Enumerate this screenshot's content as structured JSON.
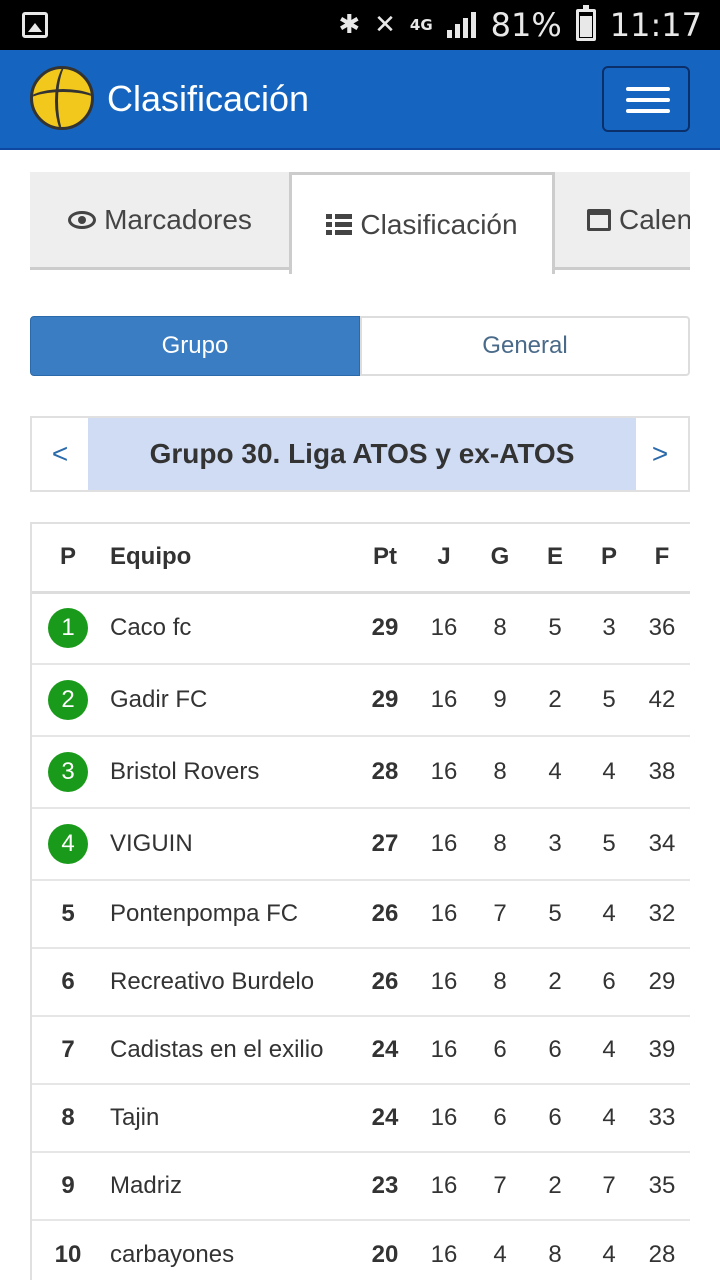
{
  "status_bar": {
    "battery": "81%",
    "time": "11:17",
    "network": "4G",
    "icons": [
      "image-icon",
      "bluetooth-icon",
      "mute-icon",
      "signal-icon",
      "battery-icon"
    ]
  },
  "navbar": {
    "title": "Clasificación",
    "logo": "volleyball-logo",
    "menu_icon": "hamburger-menu-icon",
    "color": "#1565c0"
  },
  "tabs": [
    {
      "label": "Marcadores",
      "icon": "eye-icon",
      "active": false
    },
    {
      "label": "Clasificación",
      "icon": "list-icon",
      "active": true
    },
    {
      "label": "Calendario",
      "icon": "calendar-icon",
      "active": false
    }
  ],
  "toggle": {
    "grupo": "Grupo",
    "general": "General",
    "selected": "Grupo"
  },
  "pager": {
    "prev": "<",
    "title": "Grupo 30. Liga ATOS y ex-ATOS",
    "next": ">"
  },
  "table": {
    "headers": [
      "P",
      "Equipo",
      "Pt",
      "J",
      "G",
      "E",
      "P",
      "F"
    ],
    "rows": [
      {
        "pos": "1",
        "team": "Caco fc",
        "pt": "29",
        "j": "16",
        "g": "8",
        "e": "5",
        "p": "3",
        "f": "36",
        "highlight": true
      },
      {
        "pos": "2",
        "team": "Gadir FC",
        "pt": "29",
        "j": "16",
        "g": "9",
        "e": "2",
        "p": "5",
        "f": "42",
        "highlight": true
      },
      {
        "pos": "3",
        "team": "Bristol Rovers",
        "pt": "28",
        "j": "16",
        "g": "8",
        "e": "4",
        "p": "4",
        "f": "38",
        "highlight": true
      },
      {
        "pos": "4",
        "team": "VIGUIN",
        "pt": "27",
        "j": "16",
        "g": "8",
        "e": "3",
        "p": "5",
        "f": "34",
        "highlight": true
      },
      {
        "pos": "5",
        "team": "Pontenpompa FC",
        "pt": "26",
        "j": "16",
        "g": "7",
        "e": "5",
        "p": "4",
        "f": "32",
        "highlight": false
      },
      {
        "pos": "6",
        "team": "Recreativo Burdelo",
        "pt": "26",
        "j": "16",
        "g": "8",
        "e": "2",
        "p": "6",
        "f": "29",
        "highlight": false
      },
      {
        "pos": "7",
        "team": "Cadistas en el exilio",
        "pt": "24",
        "j": "16",
        "g": "6",
        "e": "6",
        "p": "4",
        "f": "39",
        "highlight": false
      },
      {
        "pos": "8",
        "team": "Tajin",
        "pt": "24",
        "j": "16",
        "g": "6",
        "e": "6",
        "p": "4",
        "f": "33",
        "highlight": false
      },
      {
        "pos": "9",
        "team": "Madriz",
        "pt": "23",
        "j": "16",
        "g": "7",
        "e": "2",
        "p": "7",
        "f": "35",
        "highlight": false
      },
      {
        "pos": "10",
        "team": "carbayones",
        "pt": "20",
        "j": "16",
        "g": "4",
        "e": "8",
        "p": "4",
        "f": "28",
        "highlight": false
      }
    ],
    "badge_color": "#1a9a1a"
  }
}
